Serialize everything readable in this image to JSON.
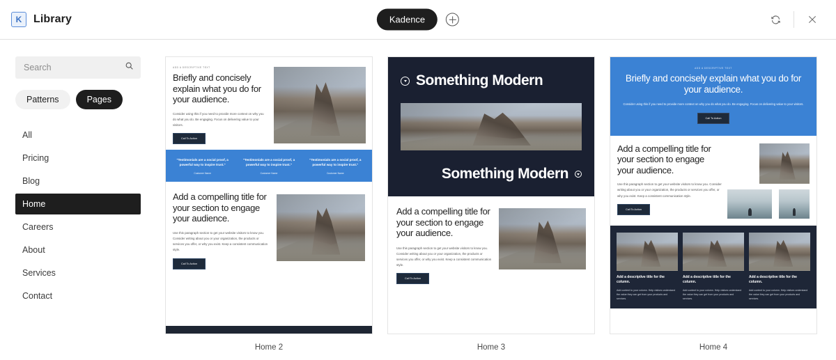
{
  "header": {
    "brand_logo": "kadence-k-logo",
    "title": "Library",
    "center_pill": "Kadence",
    "add_icon": "circle-plus-icon",
    "refresh_icon": "refresh-icon",
    "close_icon": "close-icon"
  },
  "sidebar": {
    "search": {
      "value": "",
      "placeholder": "Search",
      "icon": "search-icon"
    },
    "toggles": [
      {
        "label": "Patterns",
        "active": false
      },
      {
        "label": "Pages",
        "active": true
      }
    ],
    "nav": [
      {
        "label": "All",
        "active": false
      },
      {
        "label": "Pricing",
        "active": false
      },
      {
        "label": "Blog",
        "active": false
      },
      {
        "label": "Home",
        "active": true
      },
      {
        "label": "Careers",
        "active": false
      },
      {
        "label": "About",
        "active": false
      },
      {
        "label": "Services",
        "active": false
      },
      {
        "label": "Contact",
        "active": false
      }
    ]
  },
  "colors": {
    "accent_blue": "#3b82d4",
    "dark_navy": "#1a2031",
    "dark_ui": "#1e1e1e",
    "button_dark": "#1e2a3a"
  },
  "previews": [
    {
      "caption": "Home 2",
      "hero": {
        "eyebrow": "ADD A DESCRIPTIVE TEXT",
        "heading": "Briefly and concisely explain what you do for your audience.",
        "paragraph": "Consider using this if you need to provide more context on why you do what you do. Be engaging. Focus on delivering value to your visitors.",
        "button": "Call To Action"
      },
      "testimonials": {
        "quote": "\"Testimonials are a social proof, a powerful way to inspire trust.\"",
        "author": "Customer Name",
        "count": 3
      },
      "section": {
        "heading": "Add a compelling title for your section to engage your audience.",
        "paragraph": "Use this paragraph section to get your website visitors to know you. Consider writing about you or your organization, the products or services you offer, or why you exist. Keep a consistent communication style.",
        "button": "Call To Action"
      }
    },
    {
      "caption": "Home 3",
      "title_top": "Something Modern",
      "title_bottom": "Something Modern",
      "section": {
        "heading": "Add a compelling title for your section to engage your audience.",
        "paragraph": "Use this paragraph section to get your website visitors to know you. Consider writing about you or your organization, the products or services you offer, or why you exist. Keep a consistent communication style.",
        "button": "Call To Action"
      }
    },
    {
      "caption": "Home 4",
      "hero": {
        "eyebrow": "ADD A DESCRIPTIVE TEXT",
        "heading": "Briefly and concisely explain what you do for your audience.",
        "paragraph": "Consider using this if you need to provide more context on why you do what you do. Be engaging. Focus on delivering value to your visitors.",
        "button": "Call To Action"
      },
      "section": {
        "heading": "Add a compelling title for your section to engage your audience.",
        "paragraph": "Use this paragraph section to get your website visitors to know you. Consider writing about you or your organization, the products or services you offer, or why you exist. Keep a consistent communication style.",
        "button": "Call To Action"
      },
      "columns": {
        "heading": "Add a descriptive title for the column.",
        "paragraph": "Add content to your column. Help visitors understand the value they can get from your products and services.",
        "count": 3
      }
    }
  ]
}
